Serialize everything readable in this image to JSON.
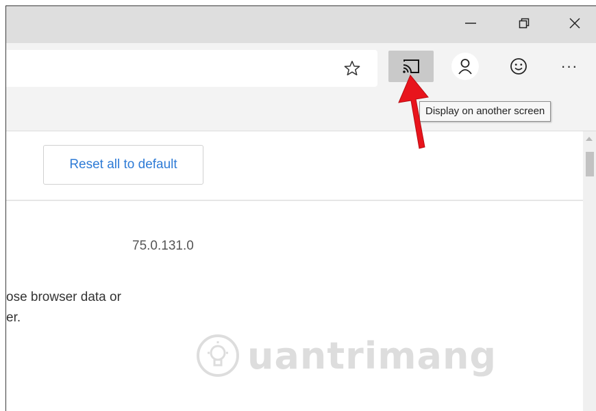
{
  "window_controls": {
    "minimize_icon": "minimize-icon",
    "restore_icon": "restore-icon",
    "close_icon": "close-icon"
  },
  "toolbar": {
    "favorite_icon": "star-icon",
    "cast_icon": "cast-icon",
    "profile_icon": "profile-icon",
    "feedback_icon": "smiley-icon",
    "more_label": "···"
  },
  "tooltip": {
    "text": "Display on another screen"
  },
  "settings": {
    "reset_button_label": "Reset all to default",
    "version": "75.0.131.0",
    "paragraph_line1": "ose browser data or",
    "paragraph_line2": "er."
  },
  "watermark": {
    "text": "uantrimang"
  },
  "colors": {
    "accent_blue": "#2e7bd6",
    "arrow_red": "#e8141c",
    "cast_button_bg": "#c9c9c9"
  }
}
